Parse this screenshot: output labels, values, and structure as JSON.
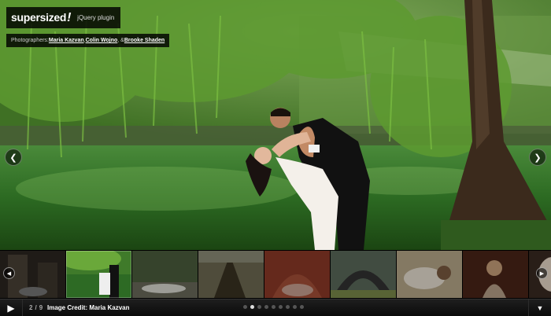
{
  "logo": {
    "wordmark": "supersized",
    "bang": "!",
    "tagline": "jQuery plugin"
  },
  "credits": {
    "prefix": "Photographers: ",
    "photographers": [
      "Maria Kazvan",
      "Colin Wojno",
      "Brooke Shaden"
    ],
    "sep1": ", ",
    "sep2": ", & "
  },
  "slideshow": {
    "current_slide": "2",
    "separator": "/",
    "total_slides": "9",
    "caption": "Image Credit: Maria Kazvan",
    "active_dot_index": 1,
    "dot_count": 9
  },
  "icons": {
    "prev": "chevron-left-icon",
    "next": "chevron-right-icon",
    "play": "play-icon",
    "tray_toggle": "triangle-down-icon"
  },
  "colors": {
    "foliage": "#4f8a2a",
    "water": "#2b6a22",
    "bar": "#111111",
    "dot_active": "#dddddd",
    "dot_inactive": "#555555"
  }
}
